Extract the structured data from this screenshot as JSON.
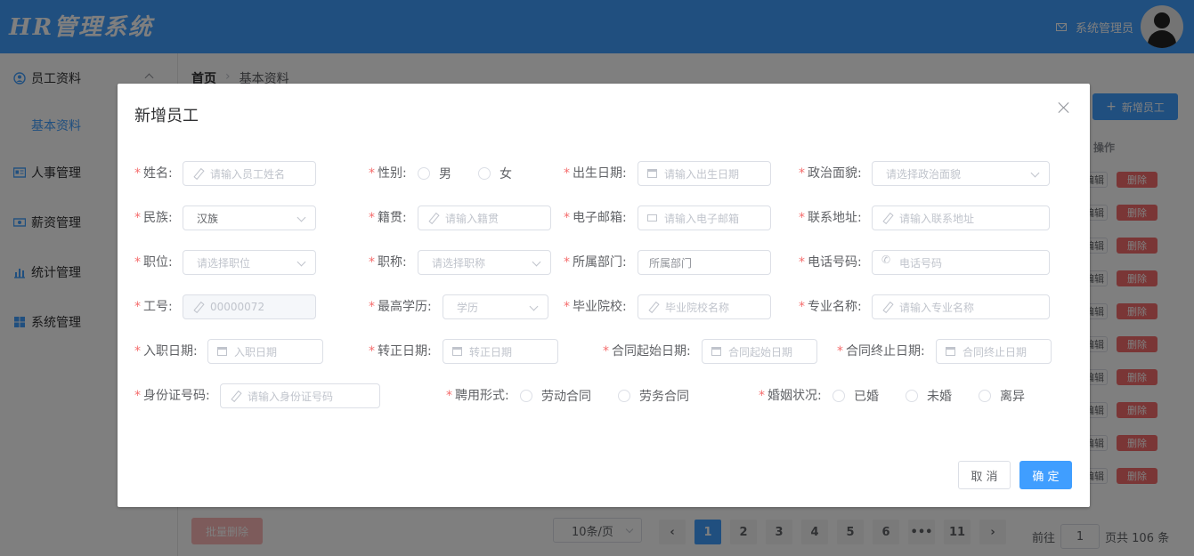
{
  "colors": {
    "primary": "#409eff",
    "danger": "#f56c6c",
    "required": "#f56c6c"
  },
  "header": {
    "logo": "HR管理系统",
    "user_name": "系统管理员"
  },
  "sidebar": {
    "items": [
      {
        "label": "员工资料",
        "icon": "user-circle-icon"
      },
      {
        "label": "基本资料"
      },
      {
        "label": "人事管理",
        "icon": "id-card-icon"
      },
      {
        "label": "薪资管理",
        "icon": "money-icon"
      },
      {
        "label": "统计管理",
        "icon": "bar-chart-icon"
      },
      {
        "label": "系统管理",
        "icon": "windows-icon"
      }
    ]
  },
  "main": {
    "breadcrumb": {
      "home": "首页",
      "current": "基本资料"
    },
    "add_button": "新增员工",
    "table": {
      "op_header": "操作",
      "edit_label": "编辑",
      "delete_label": "删除"
    },
    "batch_delete": "批量删除",
    "pagination": {
      "page_size": "10条/页",
      "pages": [
        "1",
        "2",
        "3",
        "4",
        "5",
        "6",
        "•••",
        "11"
      ],
      "active_page": "1",
      "goto_label": "前往",
      "goto_value": "1",
      "total_label": "页共 106 条"
    }
  },
  "dialog": {
    "title": "新增员工",
    "fields": {
      "name": {
        "label": "姓名:",
        "placeholder": "请输入员工姓名"
      },
      "gender": {
        "label": "性别:",
        "options": [
          "男",
          "女"
        ]
      },
      "birthday": {
        "label": "出生日期:",
        "placeholder": "请输入出生日期"
      },
      "politics": {
        "label": "政治面貌:",
        "placeholder": "请选择政治面貌"
      },
      "nation": {
        "label": "民族:",
        "value": "汉族"
      },
      "native_place": {
        "label": "籍贯:",
        "placeholder": "请输入籍贯"
      },
      "email": {
        "label": "电子邮箱:",
        "placeholder": "请输入电子邮箱"
      },
      "address": {
        "label": "联系地址:",
        "placeholder": "请输入联系地址"
      },
      "position": {
        "label": "职位:",
        "placeholder": "请选择职位"
      },
      "job_level": {
        "label": "职称:",
        "placeholder": "请选择职称"
      },
      "department": {
        "label": "所属部门:",
        "placeholder": "所属部门"
      },
      "phone": {
        "label": "电话号码:",
        "placeholder": "电话号码"
      },
      "work_id": {
        "label": "工号:",
        "value": "00000072"
      },
      "education": {
        "label": "最高学历:",
        "placeholder": "学历"
      },
      "school": {
        "label": "毕业院校:",
        "placeholder": "毕业院校名称"
      },
      "specialty": {
        "label": "专业名称:",
        "placeholder": "请输入专业名称"
      },
      "begin_date": {
        "label": "入职日期:",
        "placeholder": "入职日期"
      },
      "conversion_time": {
        "label": "转正日期:",
        "placeholder": "转正日期"
      },
      "contract_begin": {
        "label": "合同起始日期:",
        "placeholder": "合同起始日期"
      },
      "contract_end": {
        "label": "合同终止日期:",
        "placeholder": "合同终止日期"
      },
      "id_card": {
        "label": "身份证号码:",
        "placeholder": "请输入身份证号码"
      },
      "engage_form": {
        "label": "聘用形式:",
        "options": [
          "劳动合同",
          "劳务合同"
        ]
      },
      "wedlock": {
        "label": "婚姻状况:",
        "options": [
          "已婚",
          "未婚",
          "离异"
        ]
      }
    },
    "cancel_label": "取 消",
    "ok_label": "确 定"
  }
}
